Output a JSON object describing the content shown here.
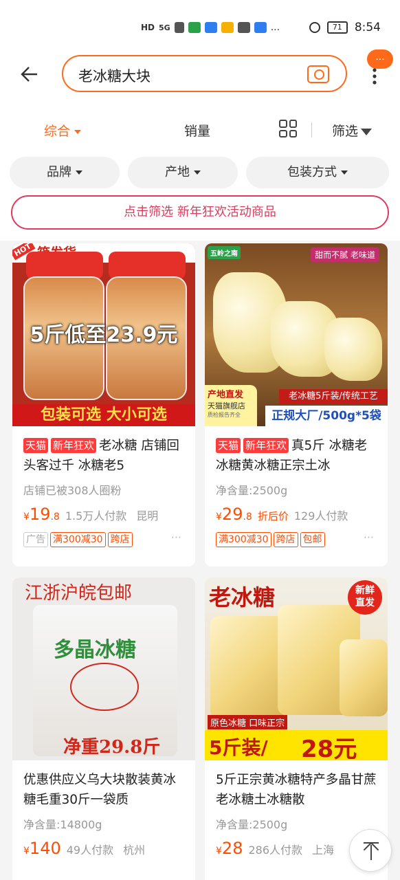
{
  "status_bar": {
    "left_icons": [
      "HD",
      "5G",
      "signal-bars-icon",
      "wechat-icon",
      "alipay-icon",
      "mail-icon",
      "message-icon",
      "browser-icon",
      "..."
    ],
    "battery": "71",
    "time": "8:54"
  },
  "search": {
    "query": "老冰糖大块",
    "more_badge": "..."
  },
  "sort": {
    "comprehensive": "综合",
    "sales": "销量",
    "filter": "筛选"
  },
  "chips": [
    "品牌",
    "产地",
    "包装方式"
  ],
  "promo": "点击筛选 新年狂欢活动商品",
  "products": [
    {
      "img_top": "箱发货",
      "img_hot": "HOT",
      "img_main": "5斤低至23.9元",
      "img_bottom": "包装可选 大小可选",
      "tags": [
        "天猫",
        "新年狂欢"
      ],
      "title": "老冰糖 店铺回头客过千 冰糖老5",
      "sub": "店铺已被308人圈粉",
      "price_int": "19",
      "price_dec": ".8",
      "price_note": "",
      "sold": "1.5万人付款",
      "city": "昆明",
      "badges": [
        "广告",
        "满300减30",
        "跨店"
      ]
    },
    {
      "img_logo": "五岭之南",
      "img_top": "甜而不腻 老味道",
      "img_flag": "产地直发",
      "img_flag2": "天猫旗舰店",
      "img_flag3": "质检报告齐全",
      "img_bottom1": "老冰糖5斤装/传统工艺",
      "img_bottom2": "正规大厂/500g*5袋",
      "tags": [
        "天猫",
        "新年狂欢"
      ],
      "title": "真5斤 冰糖老冰糖黄冰糖正宗土冰",
      "sub": "净含量:2500g",
      "price_int": "29",
      "price_dec": ".8",
      "price_note": "折后价",
      "sold": "129人付款",
      "city": "",
      "badges": [
        "满300减30",
        "跨店",
        "包邮"
      ]
    },
    {
      "img_top": "江浙沪皖包邮",
      "img_brand": "多晶冰糖",
      "img_bottom": "净重29.8斤",
      "tags": [],
      "title": "优惠供应义乌大块散装黄冰糖毛重30斤一袋质",
      "sub": "净含量:14800g",
      "price_int": "140",
      "price_dec": "",
      "price_note": "",
      "sold": "49人付款",
      "city": "杭州",
      "badges": []
    },
    {
      "img_top": "老冰糖",
      "img_badge": "新鲜直发",
      "img_flag": "原色冰糖 口味正宗",
      "img_bottom1": "5斤装/",
      "img_bottom2": "28元",
      "tags": [],
      "title": "5斤正宗黄冰糖特产多晶甘蔗老冰糖土冰糖散",
      "sub": "净含量:2500g",
      "price_int": "28",
      "price_dec": "",
      "price_note": "",
      "sold": "286人付款",
      "city": "上海",
      "badges": []
    }
  ],
  "currency": "¥",
  "more_dots": "···",
  "colors": {
    "accent": "#ff6a1a",
    "price": "#ff4c00",
    "promo": "#e0395b",
    "tmall": "#ff3c3c"
  }
}
